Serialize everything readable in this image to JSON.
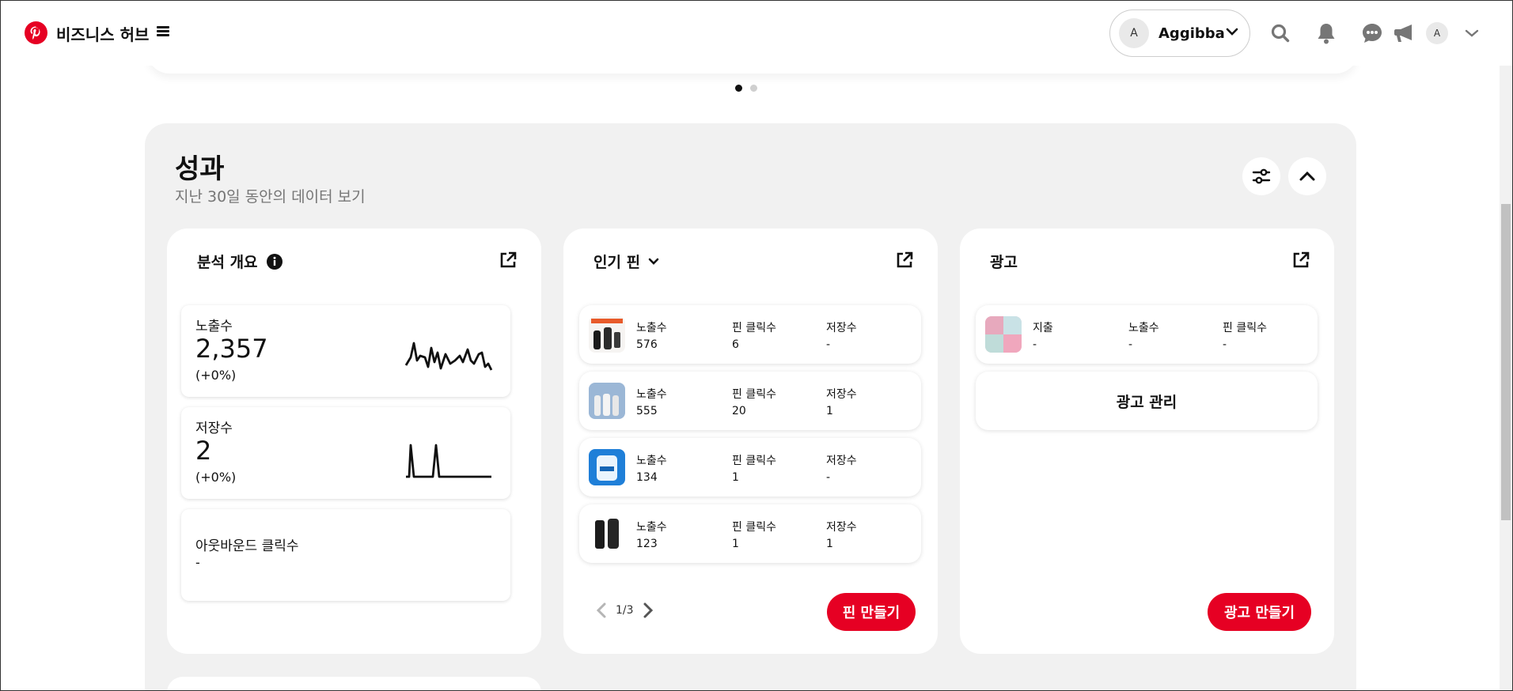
{
  "header": {
    "title": "비즈니스 허브",
    "account_initial": "A",
    "account_name": "Aggibba",
    "avatar_initial": "A"
  },
  "colors": {
    "brand": "#e60023",
    "panel_bg": "#f1f1f1"
  },
  "performance": {
    "title": "성과",
    "subtitle": "지난 30일 동안의 데이터 보기",
    "analytics": {
      "title": "분석 개요",
      "metrics": [
        {
          "label": "노출수",
          "value": "2,357",
          "change": "(+0%)"
        },
        {
          "label": "저장수",
          "value": "2",
          "change": "(+0%)"
        },
        {
          "label": "아웃바운드 클릭수",
          "value": "-"
        }
      ]
    },
    "top_pins": {
      "title": "인기 핀",
      "col_labels": [
        "노출수",
        "핀 클릭수",
        "저장수"
      ],
      "rows": [
        {
          "impressions": "576",
          "clicks": "6",
          "saves": "-"
        },
        {
          "impressions": "555",
          "clicks": "20",
          "saves": "1"
        },
        {
          "impressions": "134",
          "clicks": "1",
          "saves": "-"
        },
        {
          "impressions": "123",
          "clicks": "1",
          "saves": "1"
        }
      ],
      "page": "1/3",
      "create_label": "핀 만들기"
    },
    "ads": {
      "title": "광고",
      "col_labels": [
        "지출",
        "노출수",
        "핀 클릭수"
      ],
      "row": {
        "spend": "-",
        "impressions": "-",
        "clicks": "-"
      },
      "manage_label": "광고 관리",
      "create_label": "광고 만들기"
    }
  }
}
